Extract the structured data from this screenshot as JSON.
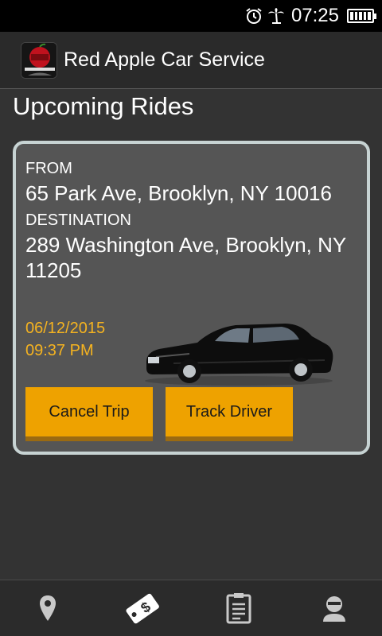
{
  "status_bar": {
    "time": "07:25",
    "icons": [
      "alarm-icon",
      "palm-tree-icon",
      "battery-icon"
    ]
  },
  "app_bar": {
    "title": "Red Apple Car Service",
    "logo_icon": "red-apple-logo"
  },
  "page": {
    "section_title": "Upcoming Rides"
  },
  "ride": {
    "from_label": "FROM",
    "from_address": "65 Park Ave, Brooklyn, NY 10016",
    "destination_label": "DESTINATION",
    "destination_address": "289 Washington Ave, Brooklyn, NY 11205",
    "date": "06/12/2015",
    "time": "09:37 PM",
    "cancel_label": "Cancel Trip",
    "track_label": "Track Driver"
  },
  "bottom_nav": {
    "items": [
      "location-pin-icon",
      "price-tag-icon",
      "clipboard-icon",
      "user-icon"
    ]
  },
  "colors": {
    "background": "#333333",
    "card": "#555555",
    "card_border": "#c7d3d3",
    "accent": "#eea200",
    "datetime": "#f5b320"
  }
}
